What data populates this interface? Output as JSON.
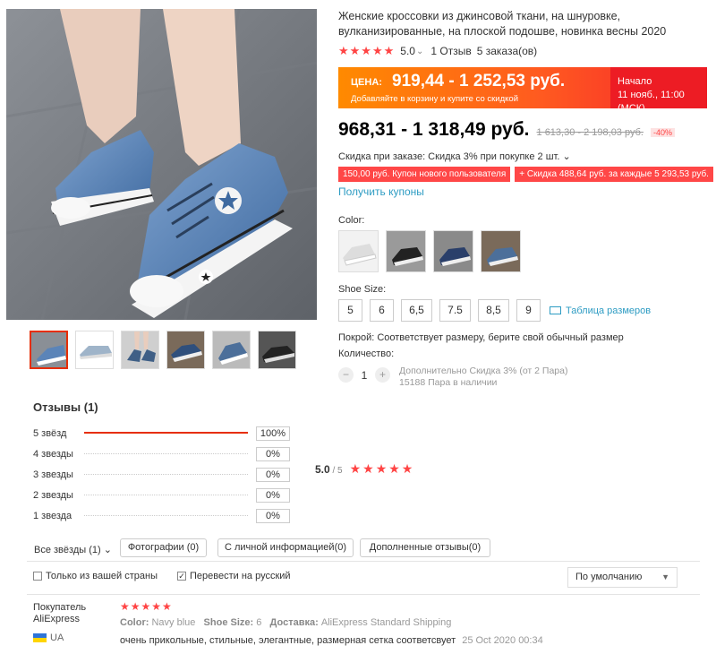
{
  "product": {
    "title": "Женские кроссовки из джинсовой ткани, на шнуровке, вулканизированные, на плоской подошве, новинка весны 2020",
    "stars": "★★★★★",
    "rating": "5.0",
    "rating_caret": "⌄",
    "reviews_link": "1 Отзыв",
    "orders": "5 заказа(ов)"
  },
  "promo": {
    "label": "ЦЕНА:",
    "price": "919,44 - 1 252,53 руб.",
    "subtitle": "Добавляйте в корзину и купите со скидкой",
    "start_title": "Начало",
    "start_date": "11 нояб., 11:00 (МСК)"
  },
  "price": {
    "current": "968,31 - 1 318,49 руб.",
    "old": "1 613,30 - 2 198,03 руб.",
    "discount": "-40%"
  },
  "bulk_discount": "Скидка при заказе: Скидка 3% при покупке 2 шт. ⌄",
  "coupons": [
    "150,00 руб. Купон нового пользователя",
    "+ Скидка 488,64 руб. за каждые 5 293,53 руб."
  ],
  "get_coupons": "Получить купоны",
  "color_label": "Color:",
  "size_label": "Shoe Size:",
  "sizes": [
    "5",
    "6",
    "6,5",
    "7.5",
    "8,5",
    "9"
  ],
  "size_chart": "Таблица размеров",
  "fit": "Покрой: Соответствует размеру, берите свой обычный размер",
  "quantity": {
    "label": "Количество:",
    "minus": "−",
    "value": "1",
    "plus": "+",
    "info_line1": "Дополнительно Скидка 3% (от 2 Пара)",
    "info_line2": "15188 Пара в наличии"
  },
  "reviews": {
    "title": "Отзывы (1)",
    "bars": [
      {
        "label": "5 звёзд",
        "pct": "100%",
        "fill": 1.0
      },
      {
        "label": "4 звезды",
        "pct": "0%",
        "fill": 0
      },
      {
        "label": "3 звезды",
        "pct": "0%",
        "fill": 0
      },
      {
        "label": "2 звезды",
        "pct": "0%",
        "fill": 0
      },
      {
        "label": "1 звезда",
        "pct": "0%",
        "fill": 0
      }
    ],
    "avg": "5.0",
    "avg_of": " / 5",
    "avg_stars": "★★★★★",
    "filter_all": "Все звёзды (1) ⌄",
    "filter_buttons": [
      "Фотографии (0)",
      "С личной информацией(0)",
      "Дополненные отзывы(0)"
    ],
    "check_country": "Только из вашей страны",
    "check_translate": "Перевести на русский",
    "check_mark": "✓",
    "sort": "По умолчанию",
    "sort_caret": "▼"
  },
  "review_item": {
    "buyer_line1": "Покупатель",
    "buyer_line2": "AliExpress",
    "country": "UA",
    "stars": "★★★★★",
    "color_label": "Color:",
    "color_value": "Navy blue",
    "size_label": "Shoe Size:",
    "size_value": "6",
    "delivery_label": "Доставка:",
    "delivery_value": "AliExpress Standard Shipping",
    "text": "очень прикольные, стильные, элегантные, размерная сетка соответсвует",
    "date": "25 Oct 2020 00:34"
  },
  "colors": {
    "accent": "#e62e04",
    "star": "#ff4444",
    "link": "#2e9cc3",
    "coupon": "#ff4747",
    "denim": "#5b84b8"
  }
}
